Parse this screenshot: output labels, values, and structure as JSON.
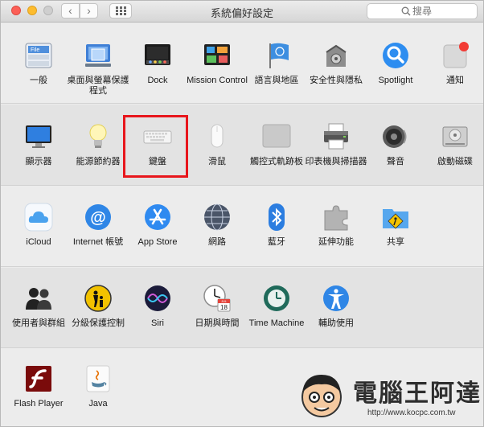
{
  "window": {
    "title": "系統偏好設定"
  },
  "toolbar": {
    "back_glyph": "‹",
    "forward_glyph": "›"
  },
  "search": {
    "placeholder": "搜尋"
  },
  "rows": [
    [
      {
        "name": "general",
        "label": "一般",
        "icon": "general-icon"
      },
      {
        "name": "desktop-screensaver",
        "label": "桌面與螢幕保護程式",
        "icon": "desktop-screensaver-icon"
      },
      {
        "name": "dock",
        "label": "Dock",
        "icon": "dock-icon"
      },
      {
        "name": "mission-control",
        "label": "Mission Control",
        "icon": "mission-control-icon"
      },
      {
        "name": "language-region",
        "label": "語言與地區",
        "icon": "language-region-icon"
      },
      {
        "name": "security-privacy",
        "label": "安全性與隱私",
        "icon": "security-privacy-icon"
      },
      {
        "name": "spotlight",
        "label": "Spotlight",
        "icon": "spotlight-icon"
      },
      {
        "name": "notifications",
        "label": "通知",
        "icon": "notifications-icon"
      }
    ],
    [
      {
        "name": "displays",
        "label": "顯示器",
        "icon": "displays-icon"
      },
      {
        "name": "energy-saver",
        "label": "能源節約器",
        "icon": "energy-saver-icon"
      },
      {
        "name": "keyboard",
        "label": "鍵盤",
        "icon": "keyboard-icon"
      },
      {
        "name": "mouse",
        "label": "滑鼠",
        "icon": "mouse-icon"
      },
      {
        "name": "trackpad",
        "label": "觸控式軌跡板",
        "icon": "trackpad-icon"
      },
      {
        "name": "printers-scanners",
        "label": "印表機與掃描器",
        "icon": "printer-icon"
      },
      {
        "name": "sound",
        "label": "聲音",
        "icon": "sound-icon"
      },
      {
        "name": "startup-disk",
        "label": "啟動磁碟",
        "icon": "startup-disk-icon"
      }
    ],
    [
      {
        "name": "icloud",
        "label": "iCloud",
        "icon": "icloud-icon"
      },
      {
        "name": "internet-accounts",
        "label": "Internet 帳號",
        "icon": "internet-accounts-icon"
      },
      {
        "name": "app-store",
        "label": "App Store",
        "icon": "app-store-icon"
      },
      {
        "name": "network",
        "label": "網路",
        "icon": "network-icon"
      },
      {
        "name": "bluetooth",
        "label": "藍牙",
        "icon": "bluetooth-icon"
      },
      {
        "name": "extensions",
        "label": "延伸功能",
        "icon": "extensions-icon"
      },
      {
        "name": "sharing",
        "label": "共享",
        "icon": "sharing-icon"
      }
    ],
    [
      {
        "name": "users-groups",
        "label": "使用者與群組",
        "icon": "users-groups-icon"
      },
      {
        "name": "parental-controls",
        "label": "分級保護控制",
        "icon": "parental-controls-icon"
      },
      {
        "name": "siri",
        "label": "Siri",
        "icon": "siri-icon"
      },
      {
        "name": "date-time",
        "label": "日期與時間",
        "icon": "date-time-icon"
      },
      {
        "name": "time-machine",
        "label": "Time Machine",
        "icon": "time-machine-icon"
      },
      {
        "name": "accessibility",
        "label": "輔助使用",
        "icon": "accessibility-icon"
      }
    ],
    [
      {
        "name": "flash-player",
        "label": "Flash Player",
        "icon": "flash-player-icon"
      },
      {
        "name": "java",
        "label": "Java",
        "icon": "java-icon"
      }
    ]
  ],
  "date_time_icon": {
    "month": "JUL",
    "day": "18"
  },
  "watermark": {
    "text": "電腦王阿達",
    "url": "http://www.kocpc.com.tw"
  },
  "colors": {
    "highlight": "#e8161c",
    "notification_dot": "#f23b35"
  }
}
